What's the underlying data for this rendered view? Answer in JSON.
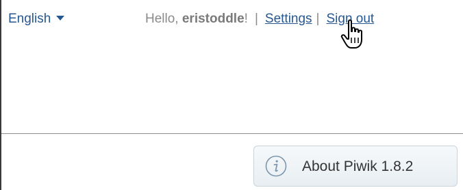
{
  "header": {
    "language_label": "English",
    "greeting_prefix": "Hello, ",
    "username": "eristoddle",
    "greeting_suffix": "!",
    "separator": "|",
    "settings_label": "Settings",
    "signout_label": "Sign out"
  },
  "footer": {
    "about_label": "About Piwik 1.8.2",
    "about_icon": "info-icon"
  },
  "cursor": {
    "type": "hand-pointer-icon"
  },
  "colors": {
    "link": "#255792",
    "muted_text": "#8a8a8a",
    "button_border": "#c9d3da"
  }
}
